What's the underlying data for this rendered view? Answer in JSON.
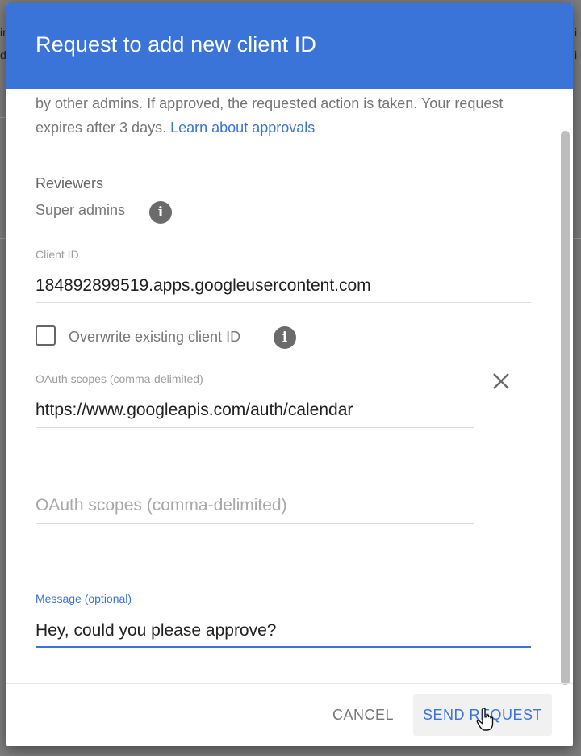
{
  "background": {
    "left_fragment_1": "ir",
    "left_fragment_2": "d",
    "right_fragment_1": "i",
    "right_fragment_2": "i"
  },
  "dialog": {
    "title": "Request to add new client ID",
    "intro_text": "by other admins. If approved, the requested action is taken. Your request expires after 3 days.",
    "intro_link": "Learn about approvals",
    "reviewers_label": "Reviewers",
    "reviewers_value": "Super admins",
    "client_id_label": "Client ID",
    "client_id_value": "184892899519.apps.googleusercontent.com",
    "overwrite_label": "Overwrite existing client ID",
    "overwrite_checked": false,
    "scopes_label": "OAuth scopes (comma-delimited)",
    "scopes_value": "https://www.googleapis.com/auth/calendar",
    "scopes_placeholder": "OAuth scopes (comma-delimited)",
    "message_label": "Message (optional)",
    "message_value": "Hey, could you please approve?",
    "cancel_label": "CANCEL",
    "send_label": "SEND REQUEST"
  },
  "colors": {
    "accent": "#3a74d9",
    "header": "#3a74d9"
  },
  "icons": {
    "info": "info-icon",
    "close": "close-icon",
    "cursor": "hand-pointer-icon"
  }
}
